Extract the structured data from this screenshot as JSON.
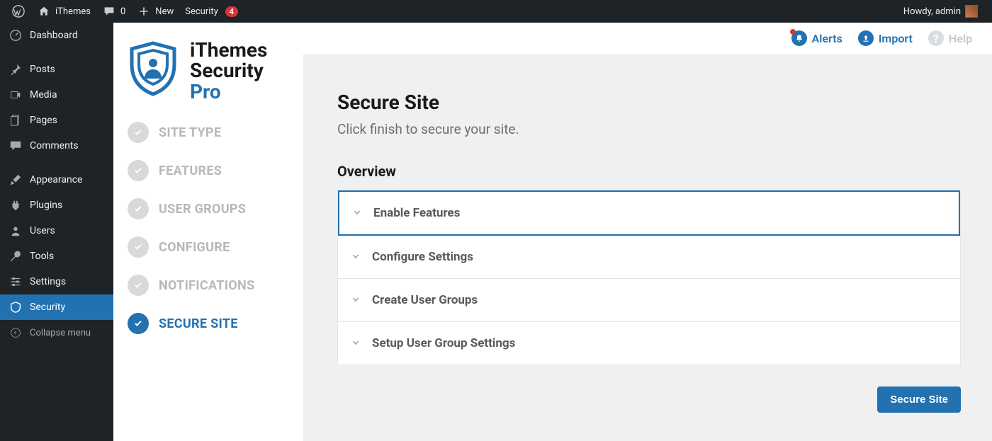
{
  "adminbar": {
    "site_name": "iThemes",
    "comment_count": "0",
    "new_label": "New",
    "security_label": "Security",
    "security_badge": "4",
    "howdy": "Howdy, admin"
  },
  "wp_menu": {
    "dashboard": "Dashboard",
    "posts": "Posts",
    "media": "Media",
    "pages": "Pages",
    "comments": "Comments",
    "appearance": "Appearance",
    "plugins": "Plugins",
    "users": "Users",
    "tools": "Tools",
    "settings": "Settings",
    "security": "Security",
    "collapse": "Collapse menu"
  },
  "brand": {
    "line1": "iThemes",
    "line2": "Security",
    "line3": "Pro"
  },
  "steps": [
    {
      "label": "SITE TYPE",
      "active": false
    },
    {
      "label": "FEATURES",
      "active": false
    },
    {
      "label": "USER GROUPS",
      "active": false
    },
    {
      "label": "CONFIGURE",
      "active": false
    },
    {
      "label": "NOTIFICATIONS",
      "active": false
    },
    {
      "label": "SECURE SITE",
      "active": true
    }
  ],
  "header": {
    "alerts": "Alerts",
    "import": "Import",
    "help": "Help"
  },
  "main": {
    "title": "Secure Site",
    "subtitle": "Click finish to secure your site.",
    "overview": "Overview",
    "accordion": [
      "Enable Features",
      "Configure Settings",
      "Create User Groups",
      "Setup User Group Settings"
    ],
    "secure_btn": "Secure Site"
  }
}
